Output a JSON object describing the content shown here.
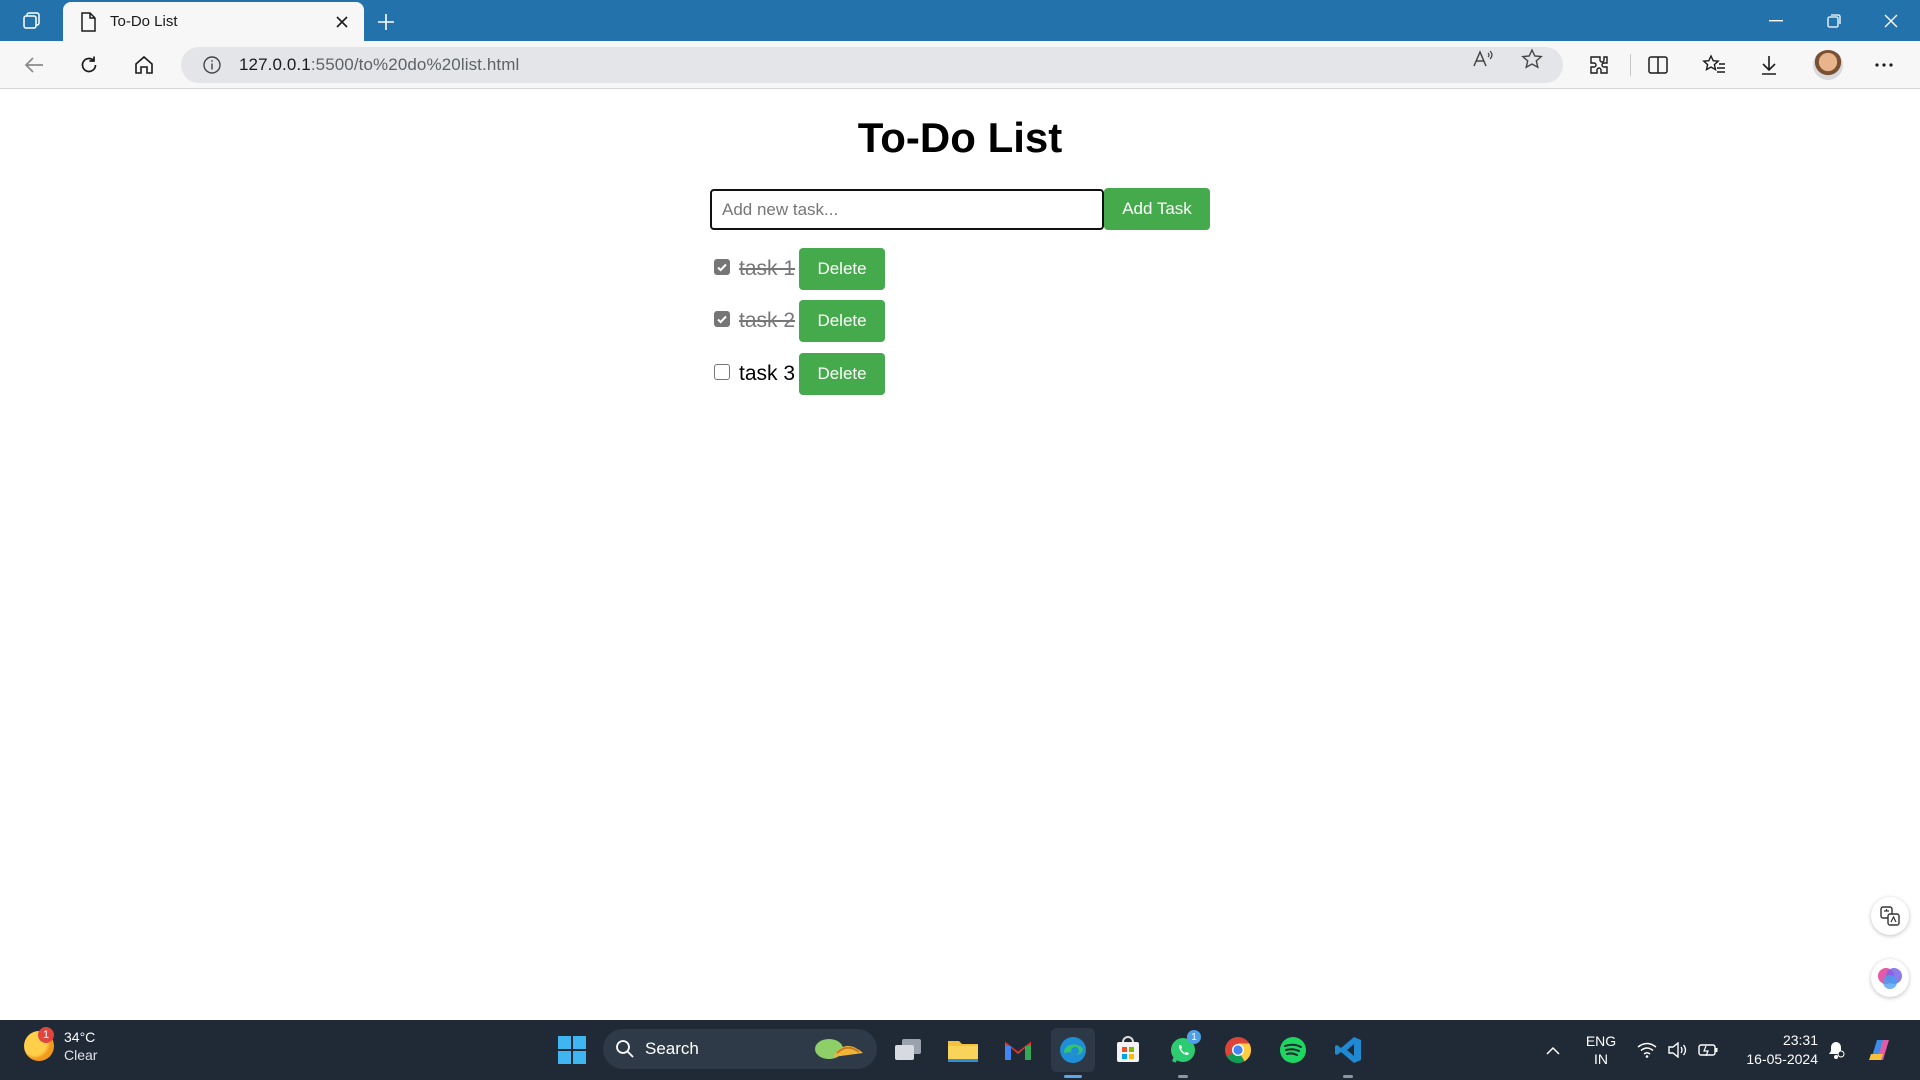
{
  "browser": {
    "tab_title": "To-Do List",
    "url_host": "127.0.0.1",
    "url_rest": ":5500/to%20do%20list.html"
  },
  "page": {
    "title": "To-Do List",
    "input_placeholder": "Add new task...",
    "input_value": "",
    "add_button_label": "Add Task",
    "tasks": [
      {
        "label": "task 1",
        "checked": true,
        "delete_label": "Delete"
      },
      {
        "label": "task 2",
        "checked": true,
        "delete_label": "Delete"
      },
      {
        "label": "task 3",
        "checked": false,
        "delete_label": "Delete"
      }
    ],
    "accent_color": "#45aa4b"
  },
  "taskbar": {
    "weather_temp": "34°C",
    "weather_condition": "Clear",
    "weather_badge": "1",
    "search_label": "Search",
    "whatsapp_badge": "1",
    "language_line1": "ENG",
    "language_line2": "IN",
    "time": "23:31",
    "date": "16-05-2024"
  }
}
